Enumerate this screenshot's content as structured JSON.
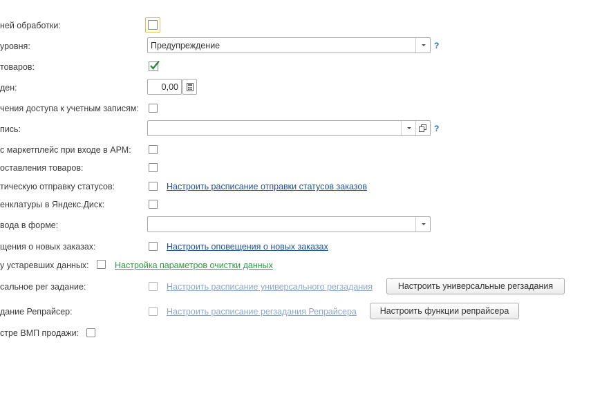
{
  "rows": {
    "r1": {
      "label": "ней обработки:"
    },
    "r2": {
      "label": "уровня:",
      "value": "Предупреждение",
      "help": "?"
    },
    "r3": {
      "label": " товаров:"
    },
    "r4": {
      "label": "ден:",
      "value": "0,00"
    },
    "r5": {
      "label": "чения доступа к учетным записям:"
    },
    "r6": {
      "label": "пись:",
      "value": "",
      "help": "?"
    },
    "r7": {
      "label": " с маркетплейс при входе в АРМ:"
    },
    "r8": {
      "label": "оставления товаров:"
    },
    "r9": {
      "label": "тическую отправку статусов:",
      "link": "Настроить расписание отправки статусов заказов"
    },
    "r10": {
      "label": "енклатуры в Яндекс.Диск:"
    },
    "r11": {
      "label": "вода в форме:",
      "value": ""
    },
    "r12": {
      "label": "щения о новых заказах:",
      "link": "Настроить оповещения о новых заказах"
    },
    "r13": {
      "label": "у устаревших данных:",
      "link": "Настройка параметров очистки данных"
    },
    "r14": {
      "label": "сальное рег задание:",
      "link": "Настроить расписание универсального регзадания",
      "button": "Настроить универсальные регзадания"
    },
    "r15": {
      "label": "дание Репрайсер:",
      "link": "Настроить расписание регзадания Репрайсера",
      "button": "Настроить функции репрайсера"
    },
    "r16": {
      "label": "стре ВМП продажи:"
    }
  },
  "colors": {
    "link": "#1c4f9c",
    "link_green": "#2e9a3e",
    "check": "#2a8a3a",
    "help": "#1f6fb5"
  }
}
